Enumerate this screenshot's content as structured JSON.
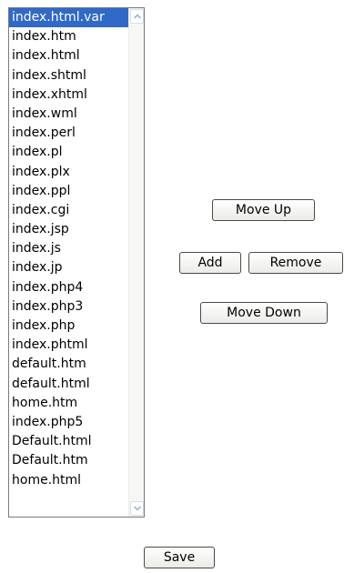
{
  "file_list": {
    "selected_index": 0,
    "items": [
      "index.html.var",
      "index.htm",
      "index.html",
      "index.shtml",
      "index.xhtml",
      "index.wml",
      "index.perl",
      "index.pl",
      "index.plx",
      "index.ppl",
      "index.cgi",
      "index.jsp",
      "index.js",
      "index.jp",
      "index.php4",
      "index.php3",
      "index.php",
      "index.phtml",
      "default.htm",
      "default.html",
      "home.htm",
      "index.php5",
      "Default.html",
      "Default.htm",
      "home.html"
    ]
  },
  "buttons": {
    "move_up": "Move Up",
    "add": "Add",
    "remove": "Remove",
    "move_down": "Move Down",
    "save": "Save"
  },
  "colors": {
    "selection": "#3169c6"
  }
}
